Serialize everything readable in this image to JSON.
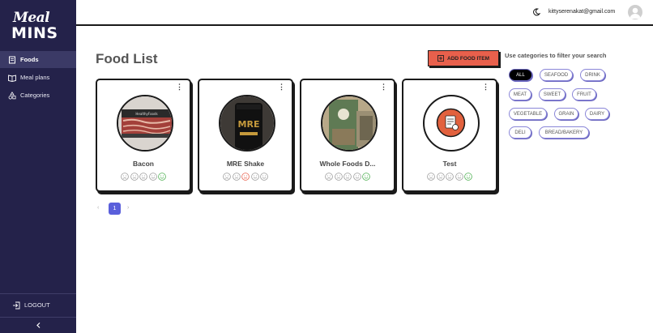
{
  "brand": {
    "line1": "Meal",
    "line2": "MINS"
  },
  "sidebar": {
    "items": [
      {
        "label": "Foods",
        "icon": "book-icon",
        "active": true
      },
      {
        "label": "Meal plans",
        "icon": "open-book-icon",
        "active": false
      },
      {
        "label": "Categories",
        "icon": "shapes-icon",
        "active": false
      }
    ],
    "logout_label": "LOGOUT"
  },
  "header": {
    "email": "kittyserenakat@gmail.com"
  },
  "main": {
    "title": "Food List",
    "add_button_label": "ADD FOOD ITEM",
    "filter_label": "Use categories to filter your search"
  },
  "categories": [
    "ALL",
    "SEAFOOD",
    "DRINK",
    "MEAT",
    "SWEET",
    "FRUIT",
    "VEGETABLE",
    "GRAIN",
    "DAIRY",
    "DELI",
    "BREAD/BAKERY"
  ],
  "selected_category": "ALL",
  "foods": [
    {
      "name": "Bacon",
      "rating_selected": 5
    },
    {
      "name": "MRE Shake",
      "rating_selected": 3
    },
    {
      "name": "Whole Foods D...",
      "rating_selected": 5
    },
    {
      "name": "Test",
      "rating_selected": 5
    }
  ],
  "pagination": {
    "current_page": "1",
    "prev": "‹",
    "next": "›"
  },
  "colors": {
    "sidebar": "#24224a",
    "accent": "#e8604c",
    "chip_border": "#8a86d8",
    "page_active": "#5a5fdb"
  }
}
